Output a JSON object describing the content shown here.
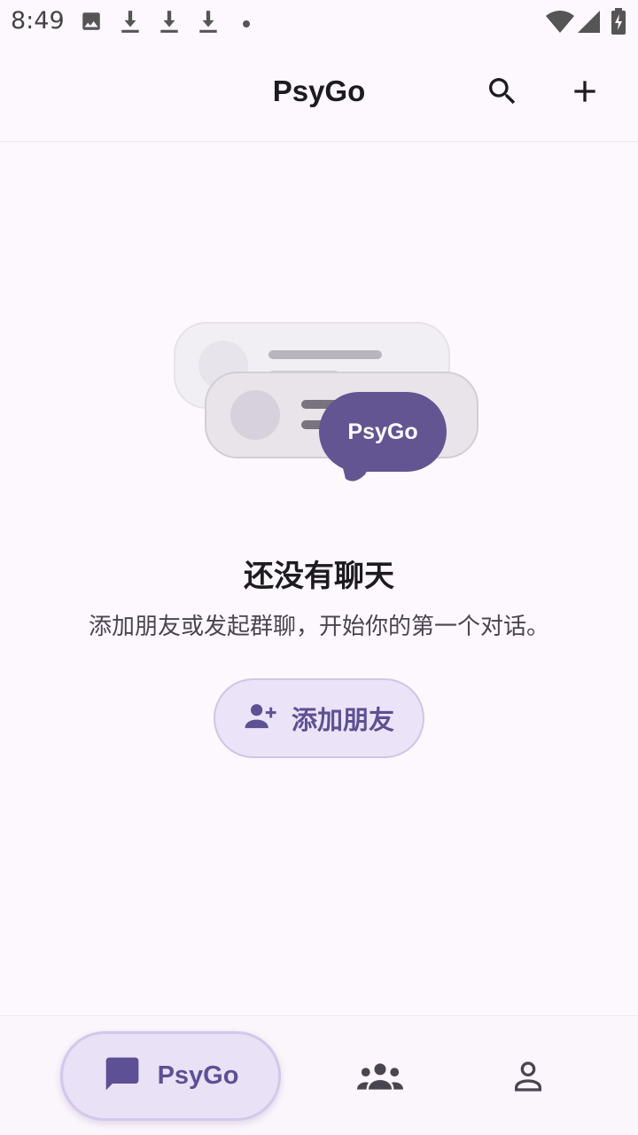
{
  "status_bar": {
    "time": "8:49",
    "left_icons": [
      "image-icon",
      "download-icon",
      "download-icon",
      "download-icon",
      "dot-icon"
    ],
    "right_icons": [
      "wifi-icon",
      "signal-icon",
      "battery-charging-icon"
    ]
  },
  "app_bar": {
    "title": "PsyGo",
    "actions": [
      "search-icon",
      "add-icon"
    ]
  },
  "illustration": {
    "bubble_label": "PsyGo"
  },
  "empty_state": {
    "title": "还没有聊天",
    "subtitle": "添加朋友或发起群聊，开始你的第一个对话。",
    "button_label": "添加朋友",
    "button_icon": "person-add-icon"
  },
  "bottom_nav": {
    "items": [
      {
        "icon": "chat-icon",
        "label": "PsyGo",
        "active": true
      },
      {
        "icon": "groups-icon",
        "label": "",
        "active": false
      },
      {
        "icon": "person-icon",
        "label": "",
        "active": false
      }
    ]
  },
  "colors": {
    "background": "#fdf8fd",
    "accent": "#5d5094",
    "accent_container": "#ebe4f8"
  }
}
